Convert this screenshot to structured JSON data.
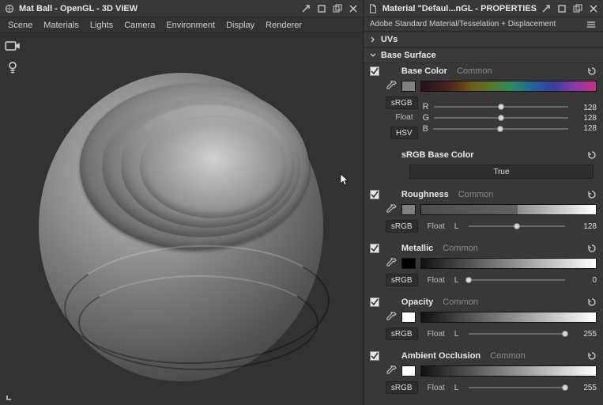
{
  "left": {
    "title": "Mat Ball - OpenGL - 3D VIEW",
    "menu": [
      "Scene",
      "Materials",
      "Lights",
      "Camera",
      "Environment",
      "Display",
      "Renderer"
    ]
  },
  "right": {
    "title": "Material \"Defaul...nGL - PROPERTIES",
    "subheader": "Adobe Standard Material/Tesselation + Displacement",
    "sections": {
      "uvs": "UVs",
      "base_surface": "Base Surface"
    },
    "base_color": {
      "label": "Base Color",
      "sub": "Common",
      "srgb_btn": "sRGB",
      "float_btn": "Float",
      "hsv_btn": "HSV",
      "r_label": "R",
      "r_val": "128",
      "g_label": "G",
      "g_val": "128",
      "b_label": "B",
      "b_val": "128"
    },
    "srgb_base_color": {
      "label": "sRGB Base Color",
      "btn": "True"
    },
    "roughness": {
      "label": "Roughness",
      "sub": "Common",
      "srgb_btn": "sRGB",
      "float_btn": "Float",
      "l_label": "L",
      "l_val": "128"
    },
    "metallic": {
      "label": "Metallic",
      "sub": "Common",
      "srgb_btn": "sRGB",
      "float_btn": "Float",
      "l_label": "L",
      "l_val": "0"
    },
    "opacity": {
      "label": "Opacity",
      "sub": "Common",
      "srgb_btn": "sRGB",
      "float_btn": "Float",
      "l_label": "L",
      "l_val": "255"
    },
    "ao": {
      "label": "Ambient Occlusion",
      "sub": "Common",
      "srgb_btn": "sRGB",
      "float_btn": "Float",
      "l_label": "L",
      "l_val": "255"
    }
  }
}
